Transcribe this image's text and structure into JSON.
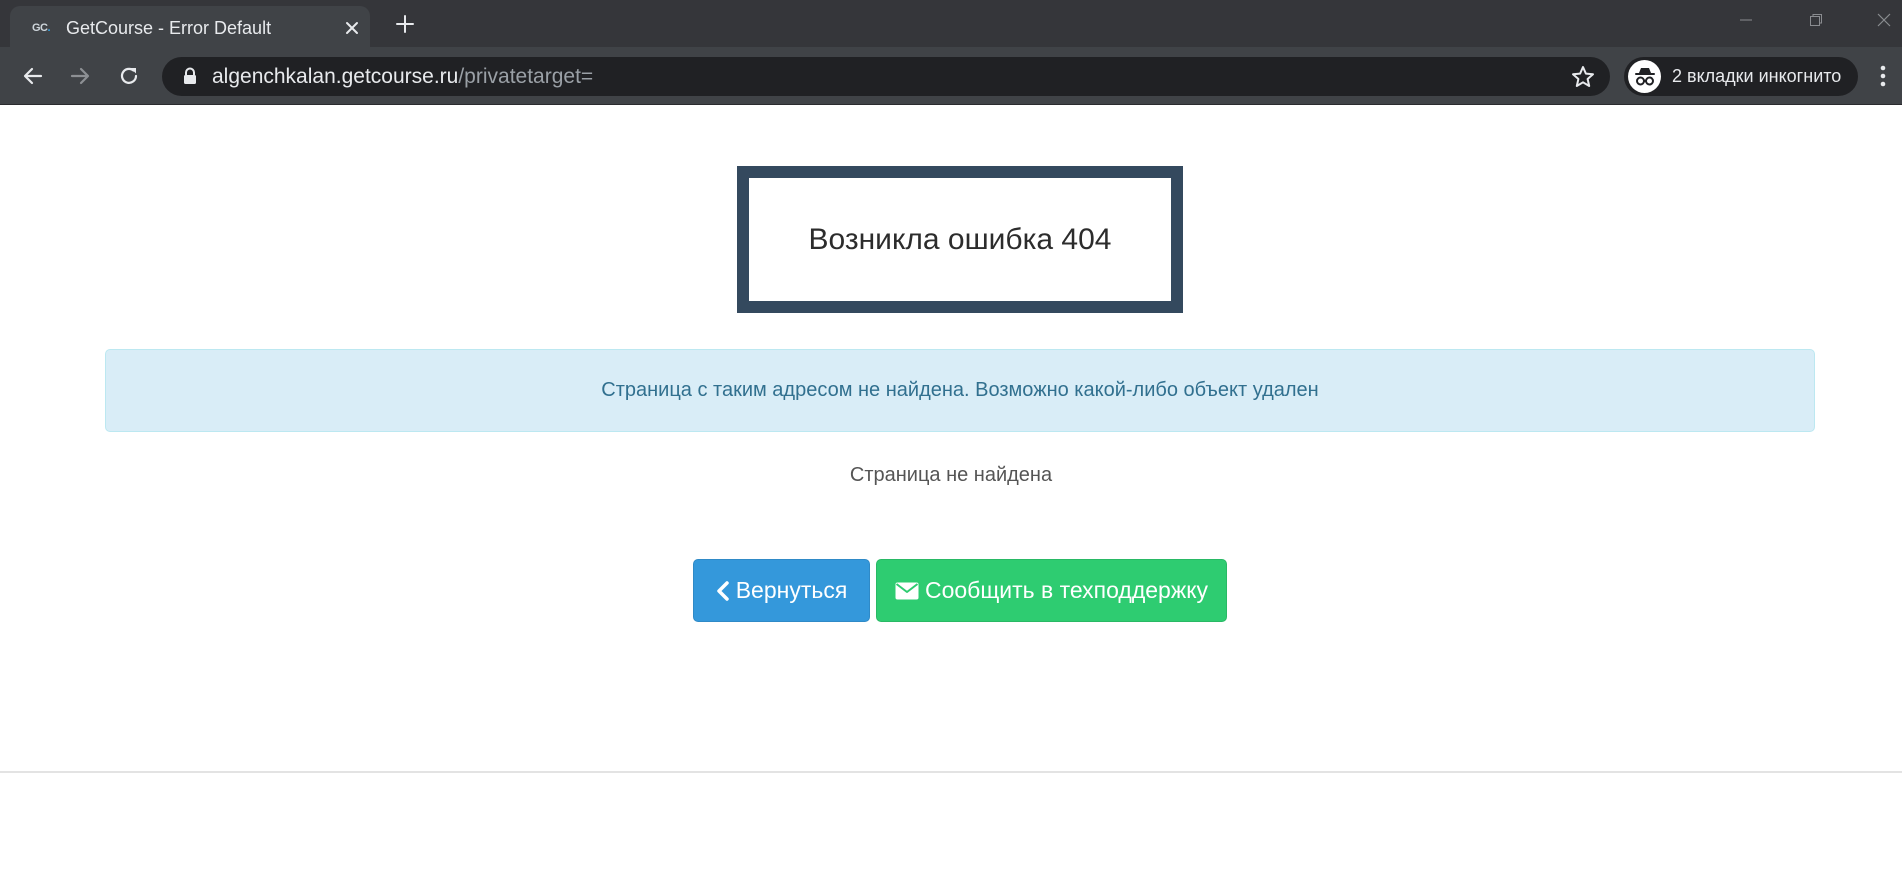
{
  "browser": {
    "tab": {
      "favicon_text": "GC",
      "title": "GetCourse - Error Default"
    },
    "address": {
      "host": "algenchkalan.getcourse.ru",
      "path": "/privatetarget="
    },
    "incognito_label": "2 вкладки инкогнито"
  },
  "page": {
    "error_title": "Возникла ошибка 404",
    "alert_message": "Страница с таким адресом не найдена. Возможно какой-либо объект удален",
    "subtext": "Страница не найдена",
    "back_button": "Вернуться",
    "support_button": "Сообщить в техподдержку"
  },
  "colors": {
    "chrome_dark": "#35363a",
    "toolbar": "#404347",
    "error_border": "#34495e",
    "alert_bg": "#d9edf7",
    "alert_text": "#31708f",
    "back_button": "#3498db",
    "support_button": "#2ecc71"
  },
  "icons": {
    "tab_close": "close-icon",
    "new_tab": "plus-icon",
    "back": "arrow-left-icon",
    "forward": "arrow-right-icon",
    "reload": "reload-icon",
    "lock": "lock-icon",
    "bookmark": "star-icon",
    "incognito": "incognito-icon",
    "menu": "kebab-menu-icon",
    "back_button_icon": "chevron-left-icon",
    "support_button_icon": "envelope-icon"
  }
}
